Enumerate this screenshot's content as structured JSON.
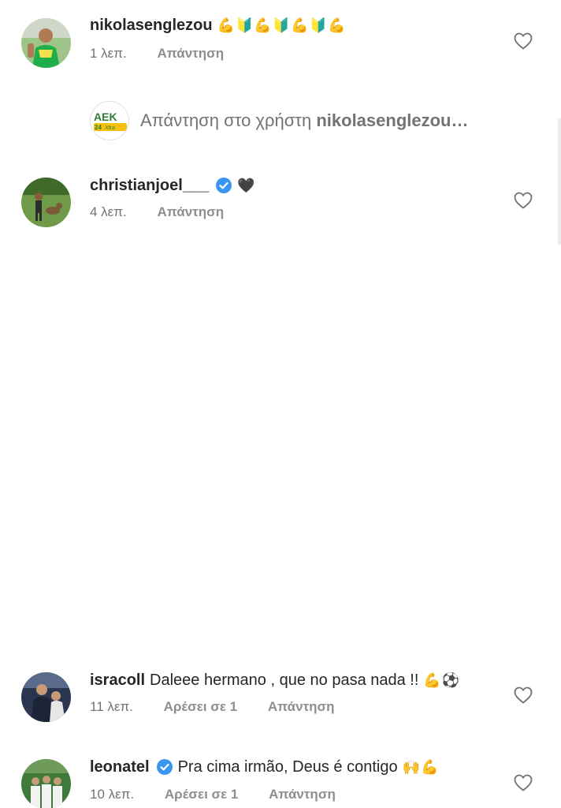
{
  "comments": [
    {
      "username": "nikolasenglezou",
      "text": "",
      "emojis": "💪🔰💪🔰💪🔰💪",
      "time": "1 λεπ.",
      "likes": "",
      "reply_label": "Απάντηση",
      "verified": false,
      "avatar_icon": "player-green-jersey-avatar"
    },
    {
      "username": "christianjoel___",
      "text": "",
      "emojis": "🖤",
      "time": "4 λεπ.",
      "likes": "",
      "reply_label": "Απάντηση",
      "verified": true,
      "avatar_icon": "player-with-dog-avatar"
    },
    {
      "username": "isracoll",
      "text": "Daleee hermano , que no pasa nada !!",
      "emojis": "💪⚽",
      "time": "11 λεπ.",
      "likes": "Αρέσει σε 1",
      "reply_label": "Απάντηση",
      "verified": false,
      "avatar_icon": "player-dark-jersey-avatar"
    },
    {
      "username": "leonatel",
      "text": "Pra cima irmão, Deus é contigo",
      "emojis": "🙌💪",
      "time": "10 λεπ.",
      "likes": "Αρέσει σε 1",
      "reply_label": "Απάντηση",
      "verified": true,
      "avatar_icon": "team-photo-avatar"
    }
  ],
  "reply_banner": {
    "prefix": "Απάντηση στο χρήστη",
    "target": "nikolasenglezou…",
    "logo_text": "AEK",
    "logo_sub": "24",
    "logo_tag": "Xtra"
  },
  "colors": {
    "verified": "#3897f0",
    "meta": "#737373",
    "text": "#262626",
    "aek_green": "#2e7d32",
    "aek_yellow": "#f4c20d"
  }
}
